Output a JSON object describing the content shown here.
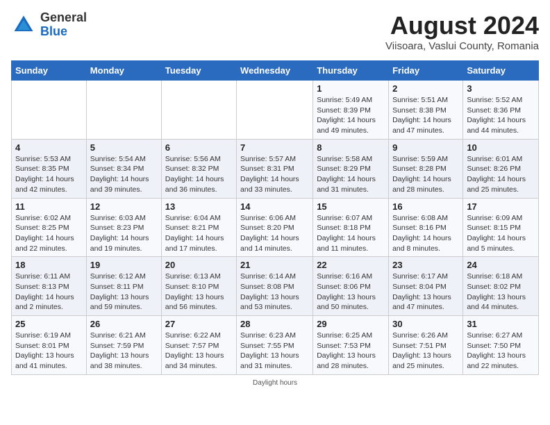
{
  "logo": {
    "general": "General",
    "blue": "Blue"
  },
  "title": "August 2024",
  "subtitle": "Viisoara, Vaslui County, Romania",
  "days_header": [
    "Sunday",
    "Monday",
    "Tuesday",
    "Wednesday",
    "Thursday",
    "Friday",
    "Saturday"
  ],
  "weeks": [
    [
      {
        "day": "",
        "info": ""
      },
      {
        "day": "",
        "info": ""
      },
      {
        "day": "",
        "info": ""
      },
      {
        "day": "",
        "info": ""
      },
      {
        "day": "1",
        "sunrise": "Sunrise: 5:49 AM",
        "sunset": "Sunset: 8:39 PM",
        "daylight": "Daylight: 14 hours and 49 minutes."
      },
      {
        "day": "2",
        "sunrise": "Sunrise: 5:51 AM",
        "sunset": "Sunset: 8:38 PM",
        "daylight": "Daylight: 14 hours and 47 minutes."
      },
      {
        "day": "3",
        "sunrise": "Sunrise: 5:52 AM",
        "sunset": "Sunset: 8:36 PM",
        "daylight": "Daylight: 14 hours and 44 minutes."
      }
    ],
    [
      {
        "day": "4",
        "sunrise": "Sunrise: 5:53 AM",
        "sunset": "Sunset: 8:35 PM",
        "daylight": "Daylight: 14 hours and 42 minutes."
      },
      {
        "day": "5",
        "sunrise": "Sunrise: 5:54 AM",
        "sunset": "Sunset: 8:34 PM",
        "daylight": "Daylight: 14 hours and 39 minutes."
      },
      {
        "day": "6",
        "sunrise": "Sunrise: 5:56 AM",
        "sunset": "Sunset: 8:32 PM",
        "daylight": "Daylight: 14 hours and 36 minutes."
      },
      {
        "day": "7",
        "sunrise": "Sunrise: 5:57 AM",
        "sunset": "Sunset: 8:31 PM",
        "daylight": "Daylight: 14 hours and 33 minutes."
      },
      {
        "day": "8",
        "sunrise": "Sunrise: 5:58 AM",
        "sunset": "Sunset: 8:29 PM",
        "daylight": "Daylight: 14 hours and 31 minutes."
      },
      {
        "day": "9",
        "sunrise": "Sunrise: 5:59 AM",
        "sunset": "Sunset: 8:28 PM",
        "daylight": "Daylight: 14 hours and 28 minutes."
      },
      {
        "day": "10",
        "sunrise": "Sunrise: 6:01 AM",
        "sunset": "Sunset: 8:26 PM",
        "daylight": "Daylight: 14 hours and 25 minutes."
      }
    ],
    [
      {
        "day": "11",
        "sunrise": "Sunrise: 6:02 AM",
        "sunset": "Sunset: 8:25 PM",
        "daylight": "Daylight: 14 hours and 22 minutes."
      },
      {
        "day": "12",
        "sunrise": "Sunrise: 6:03 AM",
        "sunset": "Sunset: 8:23 PM",
        "daylight": "Daylight: 14 hours and 19 minutes."
      },
      {
        "day": "13",
        "sunrise": "Sunrise: 6:04 AM",
        "sunset": "Sunset: 8:21 PM",
        "daylight": "Daylight: 14 hours and 17 minutes."
      },
      {
        "day": "14",
        "sunrise": "Sunrise: 6:06 AM",
        "sunset": "Sunset: 8:20 PM",
        "daylight": "Daylight: 14 hours and 14 minutes."
      },
      {
        "day": "15",
        "sunrise": "Sunrise: 6:07 AM",
        "sunset": "Sunset: 8:18 PM",
        "daylight": "Daylight: 14 hours and 11 minutes."
      },
      {
        "day": "16",
        "sunrise": "Sunrise: 6:08 AM",
        "sunset": "Sunset: 8:16 PM",
        "daylight": "Daylight: 14 hours and 8 minutes."
      },
      {
        "day": "17",
        "sunrise": "Sunrise: 6:09 AM",
        "sunset": "Sunset: 8:15 PM",
        "daylight": "Daylight: 14 hours and 5 minutes."
      }
    ],
    [
      {
        "day": "18",
        "sunrise": "Sunrise: 6:11 AM",
        "sunset": "Sunset: 8:13 PM",
        "daylight": "Daylight: 14 hours and 2 minutes."
      },
      {
        "day": "19",
        "sunrise": "Sunrise: 6:12 AM",
        "sunset": "Sunset: 8:11 PM",
        "daylight": "Daylight: 13 hours and 59 minutes."
      },
      {
        "day": "20",
        "sunrise": "Sunrise: 6:13 AM",
        "sunset": "Sunset: 8:10 PM",
        "daylight": "Daylight: 13 hours and 56 minutes."
      },
      {
        "day": "21",
        "sunrise": "Sunrise: 6:14 AM",
        "sunset": "Sunset: 8:08 PM",
        "daylight": "Daylight: 13 hours and 53 minutes."
      },
      {
        "day": "22",
        "sunrise": "Sunrise: 6:16 AM",
        "sunset": "Sunset: 8:06 PM",
        "daylight": "Daylight: 13 hours and 50 minutes."
      },
      {
        "day": "23",
        "sunrise": "Sunrise: 6:17 AM",
        "sunset": "Sunset: 8:04 PM",
        "daylight": "Daylight: 13 hours and 47 minutes."
      },
      {
        "day": "24",
        "sunrise": "Sunrise: 6:18 AM",
        "sunset": "Sunset: 8:02 PM",
        "daylight": "Daylight: 13 hours and 44 minutes."
      }
    ],
    [
      {
        "day": "25",
        "sunrise": "Sunrise: 6:19 AM",
        "sunset": "Sunset: 8:01 PM",
        "daylight": "Daylight: 13 hours and 41 minutes."
      },
      {
        "day": "26",
        "sunrise": "Sunrise: 6:21 AM",
        "sunset": "Sunset: 7:59 PM",
        "daylight": "Daylight: 13 hours and 38 minutes."
      },
      {
        "day": "27",
        "sunrise": "Sunrise: 6:22 AM",
        "sunset": "Sunset: 7:57 PM",
        "daylight": "Daylight: 13 hours and 34 minutes."
      },
      {
        "day": "28",
        "sunrise": "Sunrise: 6:23 AM",
        "sunset": "Sunset: 7:55 PM",
        "daylight": "Daylight: 13 hours and 31 minutes."
      },
      {
        "day": "29",
        "sunrise": "Sunrise: 6:25 AM",
        "sunset": "Sunset: 7:53 PM",
        "daylight": "Daylight: 13 hours and 28 minutes."
      },
      {
        "day": "30",
        "sunrise": "Sunrise: 6:26 AM",
        "sunset": "Sunset: 7:51 PM",
        "daylight": "Daylight: 13 hours and 25 minutes."
      },
      {
        "day": "31",
        "sunrise": "Sunrise: 6:27 AM",
        "sunset": "Sunset: 7:50 PM",
        "daylight": "Daylight: 13 hours and 22 minutes."
      }
    ]
  ],
  "daylight_note": "Daylight hours"
}
